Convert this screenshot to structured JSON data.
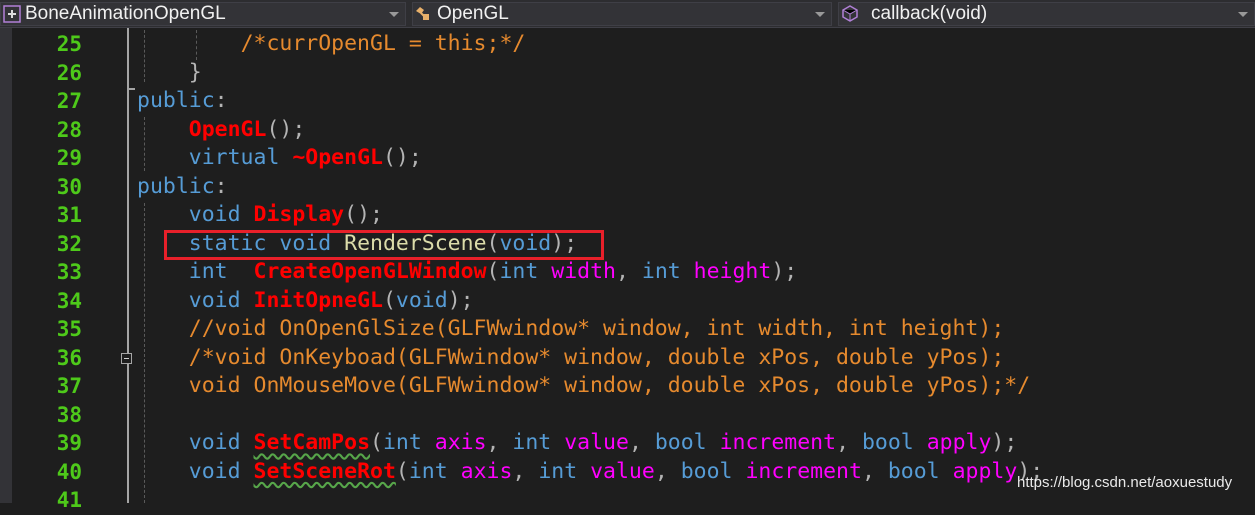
{
  "navbar": {
    "project": {
      "icon": "project-icon",
      "label": "BoneAnimationOpenGL"
    },
    "scope": {
      "icon": "class-icon",
      "label": "OpenGL"
    },
    "member": {
      "icon": "method-icon",
      "label": "callback(void)"
    }
  },
  "editor": {
    "line_numbers": [
      "25",
      "26",
      "27",
      "28",
      "29",
      "30",
      "31",
      "32",
      "33",
      "34",
      "35",
      "36",
      "37",
      "38",
      "39",
      "40",
      "41"
    ],
    "lines": [
      {
        "n": "25",
        "tokens": [
          {
            "t": "        ",
            "c": ""
          },
          {
            "t": "/*currOpenGL = this;*/",
            "c": "t-cm"
          }
        ]
      },
      {
        "n": "26",
        "tokens": [
          {
            "t": "    ",
            "c": ""
          },
          {
            "t": "}",
            "c": "t-p"
          }
        ]
      },
      {
        "n": "27",
        "tokens": [
          {
            "t": "public",
            "c": "t-kw"
          },
          {
            "t": ":",
            "c": "t-p"
          }
        ]
      },
      {
        "n": "28",
        "tokens": [
          {
            "t": "    ",
            "c": ""
          },
          {
            "t": "OpenGL",
            "c": "t-fn"
          },
          {
            "t": "();",
            "c": "t-p"
          }
        ]
      },
      {
        "n": "29",
        "tokens": [
          {
            "t": "    ",
            "c": ""
          },
          {
            "t": "virtual ",
            "c": "t-kw"
          },
          {
            "t": "~OpenGL",
            "c": "t-fn"
          },
          {
            "t": "();",
            "c": "t-p"
          }
        ]
      },
      {
        "n": "30",
        "tokens": [
          {
            "t": "public",
            "c": "t-kw"
          },
          {
            "t": ":",
            "c": "t-p"
          }
        ]
      },
      {
        "n": "31",
        "tokens": [
          {
            "t": "    ",
            "c": ""
          },
          {
            "t": "void ",
            "c": "t-kw"
          },
          {
            "t": "Display",
            "c": "t-fn"
          },
          {
            "t": "();",
            "c": "t-p"
          }
        ]
      },
      {
        "n": "32",
        "tokens": [
          {
            "t": "    ",
            "c": ""
          },
          {
            "t": "static void ",
            "c": "t-kw"
          },
          {
            "t": "RenderScene",
            "c": "t-fnp"
          },
          {
            "t": "(",
            "c": "t-p"
          },
          {
            "t": "void",
            "c": "t-kw"
          },
          {
            "t": ");",
            "c": "t-p"
          }
        ]
      },
      {
        "n": "33",
        "tokens": [
          {
            "t": "    ",
            "c": ""
          },
          {
            "t": "int  ",
            "c": "t-kw"
          },
          {
            "t": "CreateOpenGLWindow",
            "c": "t-fn"
          },
          {
            "t": "(",
            "c": "t-p"
          },
          {
            "t": "int ",
            "c": "t-kw"
          },
          {
            "t": "width",
            "c": "t-par"
          },
          {
            "t": ", ",
            "c": "t-p"
          },
          {
            "t": "int ",
            "c": "t-kw"
          },
          {
            "t": "height",
            "c": "t-par"
          },
          {
            "t": ");",
            "c": "t-p"
          }
        ]
      },
      {
        "n": "34",
        "tokens": [
          {
            "t": "    ",
            "c": ""
          },
          {
            "t": "void ",
            "c": "t-kw"
          },
          {
            "t": "InitOpneGL",
            "c": "t-fn"
          },
          {
            "t": "(",
            "c": "t-p"
          },
          {
            "t": "void",
            "c": "t-kw"
          },
          {
            "t": ");",
            "c": "t-p"
          }
        ]
      },
      {
        "n": "35",
        "tokens": [
          {
            "t": "    ",
            "c": ""
          },
          {
            "t": "//void OnOpenGlSize(GLFWwindow* window, int width, int height);",
            "c": "t-cm"
          }
        ]
      },
      {
        "n": "36",
        "tokens": [
          {
            "t": "    ",
            "c": ""
          },
          {
            "t": "/*void OnKeyboad(GLFWwindow* window, double xPos, double yPos);",
            "c": "t-cm"
          }
        ]
      },
      {
        "n": "37",
        "tokens": [
          {
            "t": "    ",
            "c": ""
          },
          {
            "t": "void OnMouseMove(GLFWwindow* window, double xPos, double yPos);*/",
            "c": "t-cm"
          }
        ]
      },
      {
        "n": "38",
        "tokens": []
      },
      {
        "n": "39",
        "tokens": [
          {
            "t": "    ",
            "c": ""
          },
          {
            "t": "void ",
            "c": "t-kw"
          },
          {
            "t": "SetCamPos",
            "c": "t-fn squiggle"
          },
          {
            "t": "(",
            "c": "t-p"
          },
          {
            "t": "int ",
            "c": "t-kw"
          },
          {
            "t": "axis",
            "c": "t-par"
          },
          {
            "t": ", ",
            "c": "t-p"
          },
          {
            "t": "int ",
            "c": "t-kw"
          },
          {
            "t": "value",
            "c": "t-par"
          },
          {
            "t": ", ",
            "c": "t-p"
          },
          {
            "t": "bool ",
            "c": "t-kw"
          },
          {
            "t": "increment",
            "c": "t-par"
          },
          {
            "t": ", ",
            "c": "t-p"
          },
          {
            "t": "bool ",
            "c": "t-kw"
          },
          {
            "t": "apply",
            "c": "t-par"
          },
          {
            "t": ");",
            "c": "t-p"
          }
        ]
      },
      {
        "n": "40",
        "tokens": [
          {
            "t": "    ",
            "c": ""
          },
          {
            "t": "void ",
            "c": "t-kw"
          },
          {
            "t": "SetSceneRot",
            "c": "t-fn squiggle"
          },
          {
            "t": "(",
            "c": "t-p"
          },
          {
            "t": "int ",
            "c": "t-kw"
          },
          {
            "t": "axis",
            "c": "t-par"
          },
          {
            "t": ", ",
            "c": "t-p"
          },
          {
            "t": "int ",
            "c": "t-kw"
          },
          {
            "t": "value",
            "c": "t-par"
          },
          {
            "t": ", ",
            "c": "t-p"
          },
          {
            "t": "bool ",
            "c": "t-kw"
          },
          {
            "t": "increment",
            "c": "t-par"
          },
          {
            "t": ", ",
            "c": "t-p"
          },
          {
            "t": "bool ",
            "c": "t-kw"
          },
          {
            "t": "apply",
            "c": "t-par"
          },
          {
            "t": ");",
            "c": "t-p"
          }
        ]
      },
      {
        "n": "41",
        "tokens": []
      }
    ],
    "highlighted_line": "32"
  },
  "watermark": "https://blog.csdn.net/aoxuestudy"
}
